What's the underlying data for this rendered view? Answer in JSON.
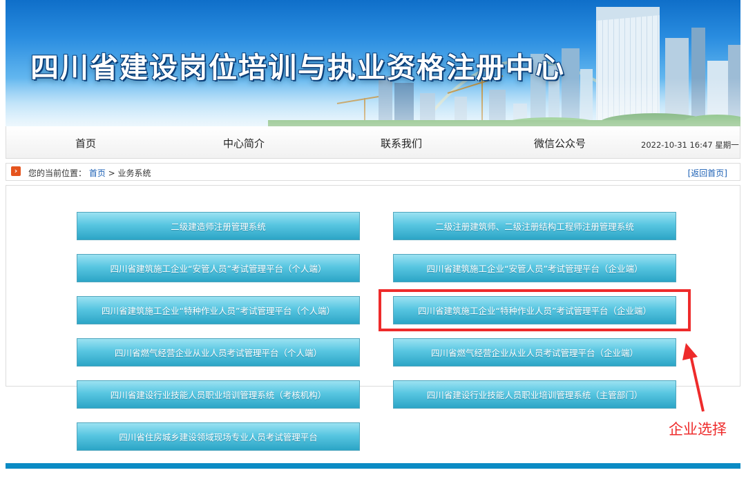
{
  "header": {
    "title": "四川省建设岗位培训与执业资格注册中心"
  },
  "nav": {
    "items": [
      "首页",
      "中心简介",
      "联系我们",
      "微信公众号"
    ],
    "datetime": "2022-10-31 16:47 星期一"
  },
  "breadcrumb": {
    "prefix": "您的当前位置：",
    "home": "首页",
    "separator": " > ",
    "current": "业务系统",
    "back_link": "[返回首页]"
  },
  "systems": [
    "二级建造师注册管理系统",
    "二级注册建筑师、二级注册结构工程师注册管理系统",
    "四川省建筑施工企业“安管人员”考试管理平台（个人端）",
    "四川省建筑施工企业“安管人员”考试管理平台（企业端）",
    "四川省建筑施工企业“特种作业人员”考试管理平台（个人端）",
    "四川省建筑施工企业“特种作业人员”考试管理平台（企业端）",
    "四川省燃气经营企业从业人员考试管理平台（个人端）",
    "四川省燃气经营企业从业人员考试管理平台（企业端）",
    "四川省建设行业技能人员职业培训管理系统（考核机构）",
    "四川省建设行业技能人员职业培训管理系统（主管部门）",
    "四川省住房城乡建设领域现场专业人员考试管理平台"
  ],
  "annotation": {
    "text": "企业选择",
    "color": "#ee2b2b"
  },
  "colors": {
    "accent": "#0b8bc4",
    "button": "#3bb3d3",
    "highlight": "#ee2b2b"
  }
}
